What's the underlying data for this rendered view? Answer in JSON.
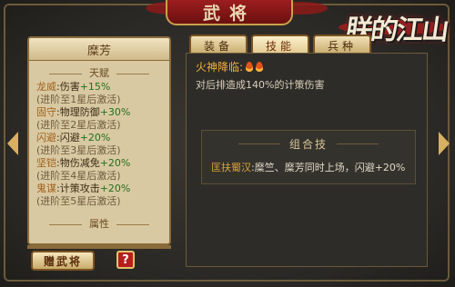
{
  "header": {
    "title": "武将"
  },
  "logo": {
    "text": "朕的江山"
  },
  "hero": {
    "name": "糜芳"
  },
  "sections": {
    "talent": "天赋",
    "attributes": "属性"
  },
  "talents": [
    {
      "name": "龙威",
      "effect": ":伤害",
      "bonus": "+15%",
      "note": "(进阶至1星后激活)"
    },
    {
      "name": "固守",
      "effect": ":物理防御",
      "bonus": "+30%",
      "note": "(进阶至2星后激活)"
    },
    {
      "name": "闪避",
      "effect": ":闪避",
      "bonus": "+20%",
      "note": "(进阶至3星后激活)"
    },
    {
      "name": "坚铠",
      "effect": ":物伤减免",
      "bonus": "+20%",
      "note": "(进阶至4星后激活)"
    },
    {
      "name": "鬼谋",
      "effect": ":计策攻击",
      "bonus": "+20%",
      "note": "(进阶至5星后激活)"
    }
  ],
  "tabs": [
    {
      "label": "装备",
      "active": false
    },
    {
      "label": "技能",
      "active": true
    },
    {
      "label": "兵种",
      "active": false
    }
  ],
  "skill": {
    "name": "火神降临:",
    "description": "对后排造成140%的计策伤害"
  },
  "combo": {
    "title": "组合技",
    "name": "匡扶蜀汉",
    "description": ":糜竺、糜芳同时上场，闪避+20%"
  },
  "buttons": {
    "gift": "赠武将",
    "help": "?"
  },
  "colors": {
    "accent": "#f2b13a",
    "bonus": "#22701c",
    "banner": "#a52020"
  }
}
